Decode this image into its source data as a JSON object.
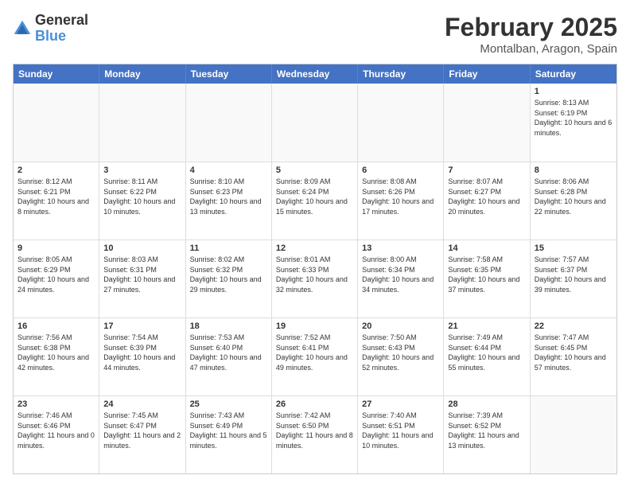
{
  "header": {
    "logo": {
      "general": "General",
      "blue": "Blue"
    },
    "month_year": "February 2025",
    "location": "Montalban, Aragon, Spain"
  },
  "weekdays": [
    "Sunday",
    "Monday",
    "Tuesday",
    "Wednesday",
    "Thursday",
    "Friday",
    "Saturday"
  ],
  "weeks": [
    [
      {
        "day": "",
        "sunrise": "",
        "sunset": "",
        "daylight": "",
        "empty": true
      },
      {
        "day": "",
        "sunrise": "",
        "sunset": "",
        "daylight": "",
        "empty": true
      },
      {
        "day": "",
        "sunrise": "",
        "sunset": "",
        "daylight": "",
        "empty": true
      },
      {
        "day": "",
        "sunrise": "",
        "sunset": "",
        "daylight": "",
        "empty": true
      },
      {
        "day": "",
        "sunrise": "",
        "sunset": "",
        "daylight": "",
        "empty": true
      },
      {
        "day": "",
        "sunrise": "",
        "sunset": "",
        "daylight": "",
        "empty": true
      },
      {
        "day": "1",
        "sunrise": "Sunrise: 8:13 AM",
        "sunset": "Sunset: 6:19 PM",
        "daylight": "Daylight: 10 hours and 6 minutes.",
        "empty": false
      }
    ],
    [
      {
        "day": "2",
        "sunrise": "Sunrise: 8:12 AM",
        "sunset": "Sunset: 6:21 PM",
        "daylight": "Daylight: 10 hours and 8 minutes.",
        "empty": false
      },
      {
        "day": "3",
        "sunrise": "Sunrise: 8:11 AM",
        "sunset": "Sunset: 6:22 PM",
        "daylight": "Daylight: 10 hours and 10 minutes.",
        "empty": false
      },
      {
        "day": "4",
        "sunrise": "Sunrise: 8:10 AM",
        "sunset": "Sunset: 6:23 PM",
        "daylight": "Daylight: 10 hours and 13 minutes.",
        "empty": false
      },
      {
        "day": "5",
        "sunrise": "Sunrise: 8:09 AM",
        "sunset": "Sunset: 6:24 PM",
        "daylight": "Daylight: 10 hours and 15 minutes.",
        "empty": false
      },
      {
        "day": "6",
        "sunrise": "Sunrise: 8:08 AM",
        "sunset": "Sunset: 6:26 PM",
        "daylight": "Daylight: 10 hours and 17 minutes.",
        "empty": false
      },
      {
        "day": "7",
        "sunrise": "Sunrise: 8:07 AM",
        "sunset": "Sunset: 6:27 PM",
        "daylight": "Daylight: 10 hours and 20 minutes.",
        "empty": false
      },
      {
        "day": "8",
        "sunrise": "Sunrise: 8:06 AM",
        "sunset": "Sunset: 6:28 PM",
        "daylight": "Daylight: 10 hours and 22 minutes.",
        "empty": false
      }
    ],
    [
      {
        "day": "9",
        "sunrise": "Sunrise: 8:05 AM",
        "sunset": "Sunset: 6:29 PM",
        "daylight": "Daylight: 10 hours and 24 minutes.",
        "empty": false
      },
      {
        "day": "10",
        "sunrise": "Sunrise: 8:03 AM",
        "sunset": "Sunset: 6:31 PM",
        "daylight": "Daylight: 10 hours and 27 minutes.",
        "empty": false
      },
      {
        "day": "11",
        "sunrise": "Sunrise: 8:02 AM",
        "sunset": "Sunset: 6:32 PM",
        "daylight": "Daylight: 10 hours and 29 minutes.",
        "empty": false
      },
      {
        "day": "12",
        "sunrise": "Sunrise: 8:01 AM",
        "sunset": "Sunset: 6:33 PM",
        "daylight": "Daylight: 10 hours and 32 minutes.",
        "empty": false
      },
      {
        "day": "13",
        "sunrise": "Sunrise: 8:00 AM",
        "sunset": "Sunset: 6:34 PM",
        "daylight": "Daylight: 10 hours and 34 minutes.",
        "empty": false
      },
      {
        "day": "14",
        "sunrise": "Sunrise: 7:58 AM",
        "sunset": "Sunset: 6:35 PM",
        "daylight": "Daylight: 10 hours and 37 minutes.",
        "empty": false
      },
      {
        "day": "15",
        "sunrise": "Sunrise: 7:57 AM",
        "sunset": "Sunset: 6:37 PM",
        "daylight": "Daylight: 10 hours and 39 minutes.",
        "empty": false
      }
    ],
    [
      {
        "day": "16",
        "sunrise": "Sunrise: 7:56 AM",
        "sunset": "Sunset: 6:38 PM",
        "daylight": "Daylight: 10 hours and 42 minutes.",
        "empty": false
      },
      {
        "day": "17",
        "sunrise": "Sunrise: 7:54 AM",
        "sunset": "Sunset: 6:39 PM",
        "daylight": "Daylight: 10 hours and 44 minutes.",
        "empty": false
      },
      {
        "day": "18",
        "sunrise": "Sunrise: 7:53 AM",
        "sunset": "Sunset: 6:40 PM",
        "daylight": "Daylight: 10 hours and 47 minutes.",
        "empty": false
      },
      {
        "day": "19",
        "sunrise": "Sunrise: 7:52 AM",
        "sunset": "Sunset: 6:41 PM",
        "daylight": "Daylight: 10 hours and 49 minutes.",
        "empty": false
      },
      {
        "day": "20",
        "sunrise": "Sunrise: 7:50 AM",
        "sunset": "Sunset: 6:43 PM",
        "daylight": "Daylight: 10 hours and 52 minutes.",
        "empty": false
      },
      {
        "day": "21",
        "sunrise": "Sunrise: 7:49 AM",
        "sunset": "Sunset: 6:44 PM",
        "daylight": "Daylight: 10 hours and 55 minutes.",
        "empty": false
      },
      {
        "day": "22",
        "sunrise": "Sunrise: 7:47 AM",
        "sunset": "Sunset: 6:45 PM",
        "daylight": "Daylight: 10 hours and 57 minutes.",
        "empty": false
      }
    ],
    [
      {
        "day": "23",
        "sunrise": "Sunrise: 7:46 AM",
        "sunset": "Sunset: 6:46 PM",
        "daylight": "Daylight: 11 hours and 0 minutes.",
        "empty": false
      },
      {
        "day": "24",
        "sunrise": "Sunrise: 7:45 AM",
        "sunset": "Sunset: 6:47 PM",
        "daylight": "Daylight: 11 hours and 2 minutes.",
        "empty": false
      },
      {
        "day": "25",
        "sunrise": "Sunrise: 7:43 AM",
        "sunset": "Sunset: 6:49 PM",
        "daylight": "Daylight: 11 hours and 5 minutes.",
        "empty": false
      },
      {
        "day": "26",
        "sunrise": "Sunrise: 7:42 AM",
        "sunset": "Sunset: 6:50 PM",
        "daylight": "Daylight: 11 hours and 8 minutes.",
        "empty": false
      },
      {
        "day": "27",
        "sunrise": "Sunrise: 7:40 AM",
        "sunset": "Sunset: 6:51 PM",
        "daylight": "Daylight: 11 hours and 10 minutes.",
        "empty": false
      },
      {
        "day": "28",
        "sunrise": "Sunrise: 7:39 AM",
        "sunset": "Sunset: 6:52 PM",
        "daylight": "Daylight: 11 hours and 13 minutes.",
        "empty": false
      },
      {
        "day": "",
        "sunrise": "",
        "sunset": "",
        "daylight": "",
        "empty": true
      }
    ]
  ]
}
